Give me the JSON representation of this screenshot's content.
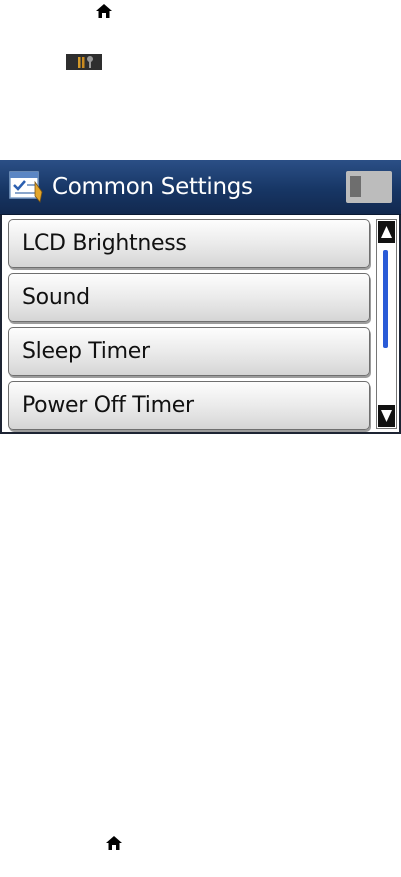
{
  "screen": {
    "title": "Common Settings",
    "menu": [
      {
        "label": "LCD Brightness"
      },
      {
        "label": "Sound"
      },
      {
        "label": "Sleep Timer"
      },
      {
        "label": "Power Off Timer"
      }
    ],
    "scroll_position_fraction": 0.0
  },
  "icons": {
    "top_home": "home-icon",
    "setup": "setup-icon",
    "header": "settings-icon",
    "status": "status-icon",
    "scroll_up": "scroll-up-arrow-icon",
    "scroll_down": "scroll-down-arrow-icon",
    "bottom_home": "home-icon"
  },
  "colors": {
    "header_blue": "#173665",
    "scroll_thumb": "#2a5bd7",
    "button_face": "#e9e9e9"
  }
}
